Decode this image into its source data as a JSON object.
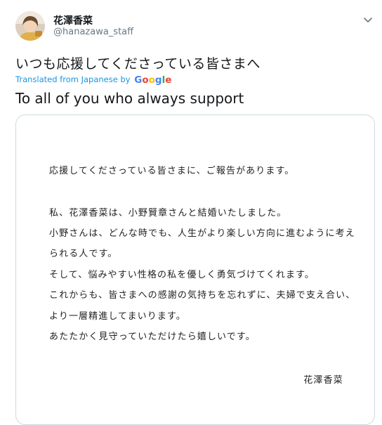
{
  "user": {
    "display_name": "花澤香菜",
    "handle": "@hanazawa_staff"
  },
  "tweet": {
    "text": "いつも応援してくださっている皆さまへ",
    "translated_label": "Translated from Japanese by",
    "google_letters": [
      {
        "char": "G",
        "color": "#4285f4"
      },
      {
        "char": "o",
        "color": "#ea4335"
      },
      {
        "char": "o",
        "color": "#fbbc05"
      },
      {
        "char": "g",
        "color": "#4285f4"
      },
      {
        "char": "l",
        "color": "#34a853"
      },
      {
        "char": "e",
        "color": "#ea4335"
      }
    ],
    "translation": "To all of you who always support"
  },
  "letter": {
    "lines": [
      "応援してくださっている皆さまに、ご報告があります。",
      "私、花澤香菜は、小野賢章さんと結婚いたしました。",
      "小野さんは、どんな時でも、人生がより楽しい方向に進むように考え",
      "られる人です。",
      "そして、悩みやすい性格の私を優しく勇気づけてくれます。",
      "これからも、皆さまへの感謝の気持ちを忘れずに、夫婦で支え合い、",
      "より一層精進してまいります。",
      "あたたかく見守っていただけたら嬉しいです。"
    ],
    "signature": "花澤香菜"
  },
  "icons": {
    "menu_caret": "chevron-down-icon"
  }
}
